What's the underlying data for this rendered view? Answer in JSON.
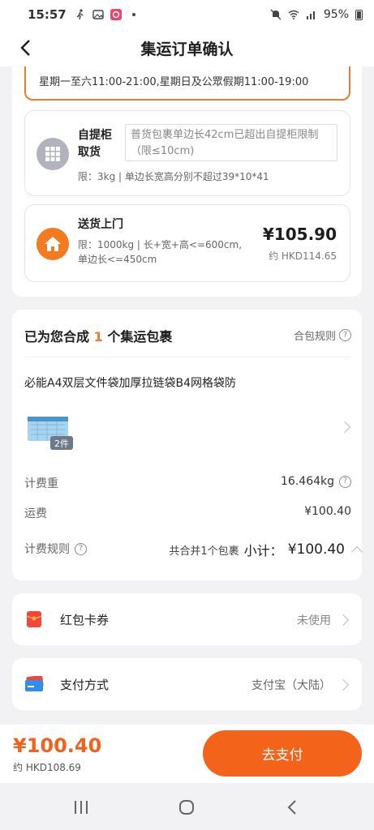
{
  "status_bar": {
    "time": "15:57",
    "battery": "95%"
  },
  "header": {
    "title": "集运订单确认"
  },
  "notice": {
    "hours": "星期一至六11:00-21:00,星期日及公眾假期11:00-19:00"
  },
  "delivery_options": [
    {
      "name_line1": "自提柜",
      "name_line2": "取货",
      "warning": "普货包裹单边长42cm已超出自提柜限制（限≤10cm)",
      "limit": "限：3kg | 单边长宽高分别不超过39*10*41",
      "icon": "locker-icon"
    },
    {
      "name": "送货上门",
      "limit_line1": "限：1000kg | 长+宽+高<=600cm,",
      "limit_line2": "单边长<=450cm",
      "price": "¥105.90",
      "price_hkd": "约 HKD114.65",
      "icon": "home-icon"
    }
  ],
  "package": {
    "title_prefix": "已为您合成",
    "count": "1",
    "title_suffix": "个集运包裹",
    "rule_link": "合包规则",
    "product_name": "必能A4双层文件袋加厚拉链袋B4网格袋防",
    "qty_badge": "2件",
    "weight_label": "计费重",
    "weight_value": "16.464kg",
    "freight_label": "运费",
    "freight_value": "¥100.40",
    "billing_rule_label": "计费规则",
    "merged_text": "共合并1个包裹",
    "subtotal_label": "小计：",
    "subtotal_value": "¥100.40"
  },
  "coupon": {
    "label": "红包卡券",
    "value": "未使用",
    "icon": "red-envelope-icon"
  },
  "payment": {
    "label": "支付方式",
    "value": "支付宝（大陆）",
    "icon": "card-icon"
  },
  "footer": {
    "total": "¥100.40",
    "total_hkd": "约 HKD108.69",
    "pay_button": "去支付"
  },
  "colors": {
    "accent": "#f4631a",
    "home_icon": "#f47a1f",
    "locker_icon": "#b0b3bd"
  }
}
